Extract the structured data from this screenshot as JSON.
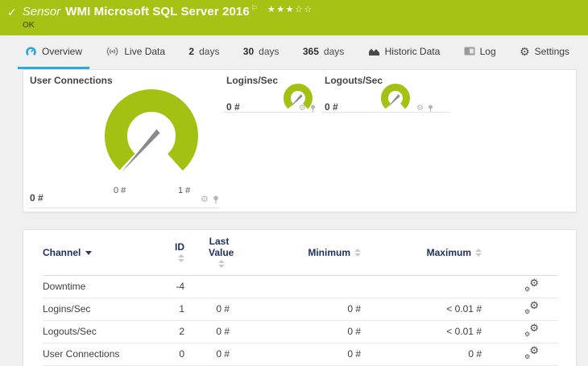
{
  "header": {
    "check": "✓",
    "kind": "Sensor",
    "title": "WMI Microsoft SQL Server 2016",
    "flag": "⚐",
    "stars": "★★★☆☆",
    "status": "OK"
  },
  "tabs": [
    {
      "label": "Overview",
      "active": true
    },
    {
      "label": "Live Data"
    },
    {
      "bold": "2",
      "label": "days"
    },
    {
      "bold": "30",
      "label": "days"
    },
    {
      "bold": "365",
      "label": "days"
    },
    {
      "label": "Historic Data"
    },
    {
      "label": "Log"
    },
    {
      "label": "Settings"
    }
  ],
  "gauges": {
    "user_connections": {
      "title": "User Connections",
      "value": "0 #",
      "scale_min": "0 #",
      "scale_max": "1 #"
    },
    "logins_per_sec": {
      "title": "Logins/Sec",
      "value": "0 #"
    },
    "logouts_per_sec": {
      "title": "Logouts/Sec",
      "value": "0 #"
    }
  },
  "table": {
    "headers": {
      "channel": "Channel",
      "id": "ID",
      "last_value": "Last Value",
      "minimum": "Minimum",
      "maximum": "Maximum"
    },
    "rows": [
      {
        "channel": "Downtime",
        "id": "-4",
        "last_value": "",
        "minimum": "",
        "maximum": ""
      },
      {
        "channel": "Logins/Sec",
        "id": "1",
        "last_value": "0 #",
        "minimum": "0 #",
        "maximum": "< 0.01 #"
      },
      {
        "channel": "Logouts/Sec",
        "id": "2",
        "last_value": "0 #",
        "minimum": "0 #",
        "maximum": "< 0.01 #"
      },
      {
        "channel": "User Connections",
        "id": "0",
        "last_value": "0 #",
        "minimum": "0 #",
        "maximum": "0 #"
      }
    ]
  },
  "colors": {
    "header_green": "#a6c214",
    "gauge_green": "#a3c113",
    "active_tab_blue": "#29a9dd",
    "table_header_navy": "#20305f",
    "needle_gray": "#8a8a8a"
  }
}
